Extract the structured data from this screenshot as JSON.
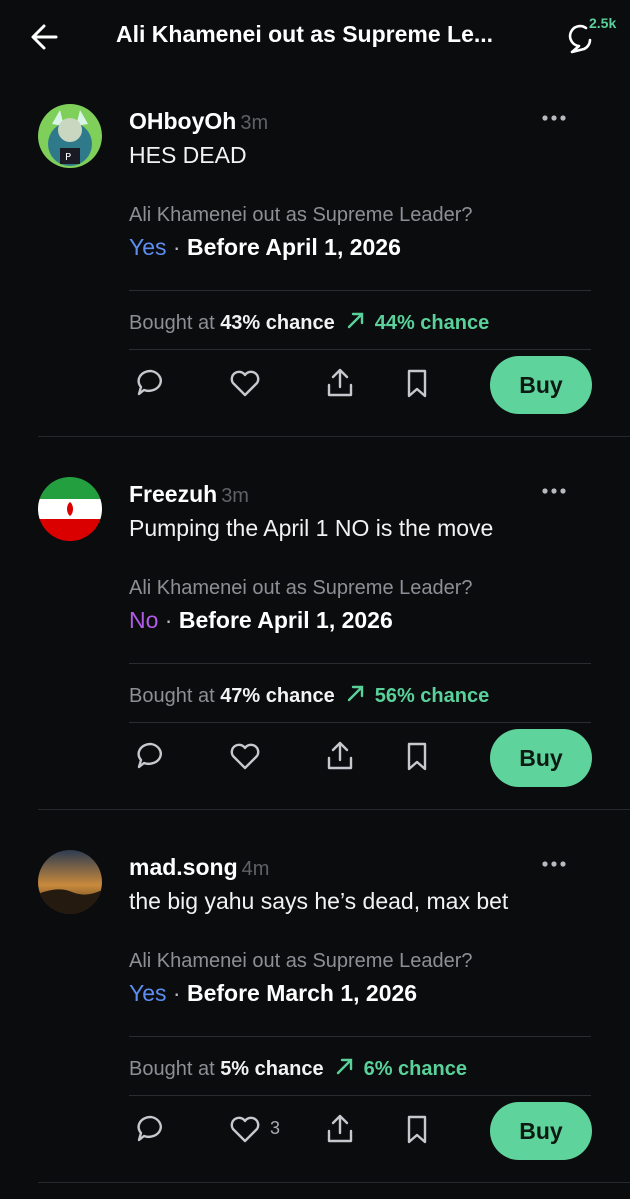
{
  "header": {
    "title": "Ali Khamenei out as Supreme Le...",
    "comments_count": "2.5k"
  },
  "colors": {
    "accent_green": "#5ed39b",
    "yes_blue": "#5d8df0",
    "no_purple": "#b05ce6",
    "background": "#0b0c0e"
  },
  "posts": [
    {
      "username": "OHboyOh",
      "time": "3m",
      "text": "HES DEAD",
      "market_question": "Ali Khamenei out as Supreme Leader?",
      "outcome": "Yes",
      "separator": " · ",
      "deadline": "Before April 1, 2026",
      "bought_label": "Bought at ",
      "bought_pct": "43% chance",
      "current_pct": "44% chance",
      "like_count": "",
      "buy_label": "Buy",
      "avatar": "cartoon-avatar"
    },
    {
      "username": "Freezuh",
      "time": "3m",
      "text": "Pumping the April 1 NO is the move",
      "market_question": "Ali Khamenei out as Supreme Leader?",
      "outcome": "No",
      "separator": " · ",
      "deadline": "Before April 1, 2026",
      "bought_label": "Bought at ",
      "bought_pct": "47% chance",
      "current_pct": "56% chance",
      "like_count": "",
      "buy_label": "Buy",
      "avatar": "iran-flag-avatar"
    },
    {
      "username": "mad.song",
      "time": "4m",
      "text": "the big yahu says he’s dead, max bet",
      "market_question": "Ali Khamenei out as Supreme Leader?",
      "outcome": "Yes",
      "separator": " · ",
      "deadline": "Before March 1, 2026",
      "bought_label": "Bought at ",
      "bought_pct": "5% chance",
      "current_pct": "6% chance",
      "like_count": "3",
      "buy_label": "Buy",
      "avatar": "sunset-avatar"
    }
  ]
}
